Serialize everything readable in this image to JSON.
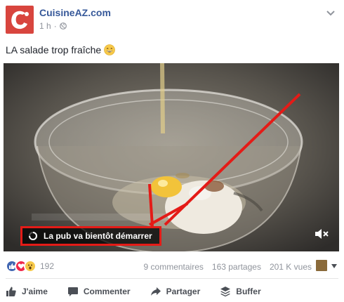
{
  "post": {
    "page_name": "CuisineAZ.com",
    "time": "1 h",
    "privacy_icon": "globe-icon",
    "text": "LA salade trop fraîche",
    "emoji": "grinning-face-emoji"
  },
  "video": {
    "ad_notice": "La pub va bientôt démarrer",
    "mute_icon": "speaker-muted-icon",
    "annotation_color": "#e41b17"
  },
  "stats": {
    "reactions": [
      "like",
      "love",
      "wow"
    ],
    "reaction_count": "192",
    "comments": "9 commentaires",
    "shares": "163 partages",
    "views": "201 K vues"
  },
  "actions": {
    "like": "J'aime",
    "comment": "Commenter",
    "share": "Partager",
    "buffer": "Buffer"
  },
  "colors": {
    "brand": "#d8453e",
    "link": "#365899",
    "secondary_text": "#90949c"
  }
}
